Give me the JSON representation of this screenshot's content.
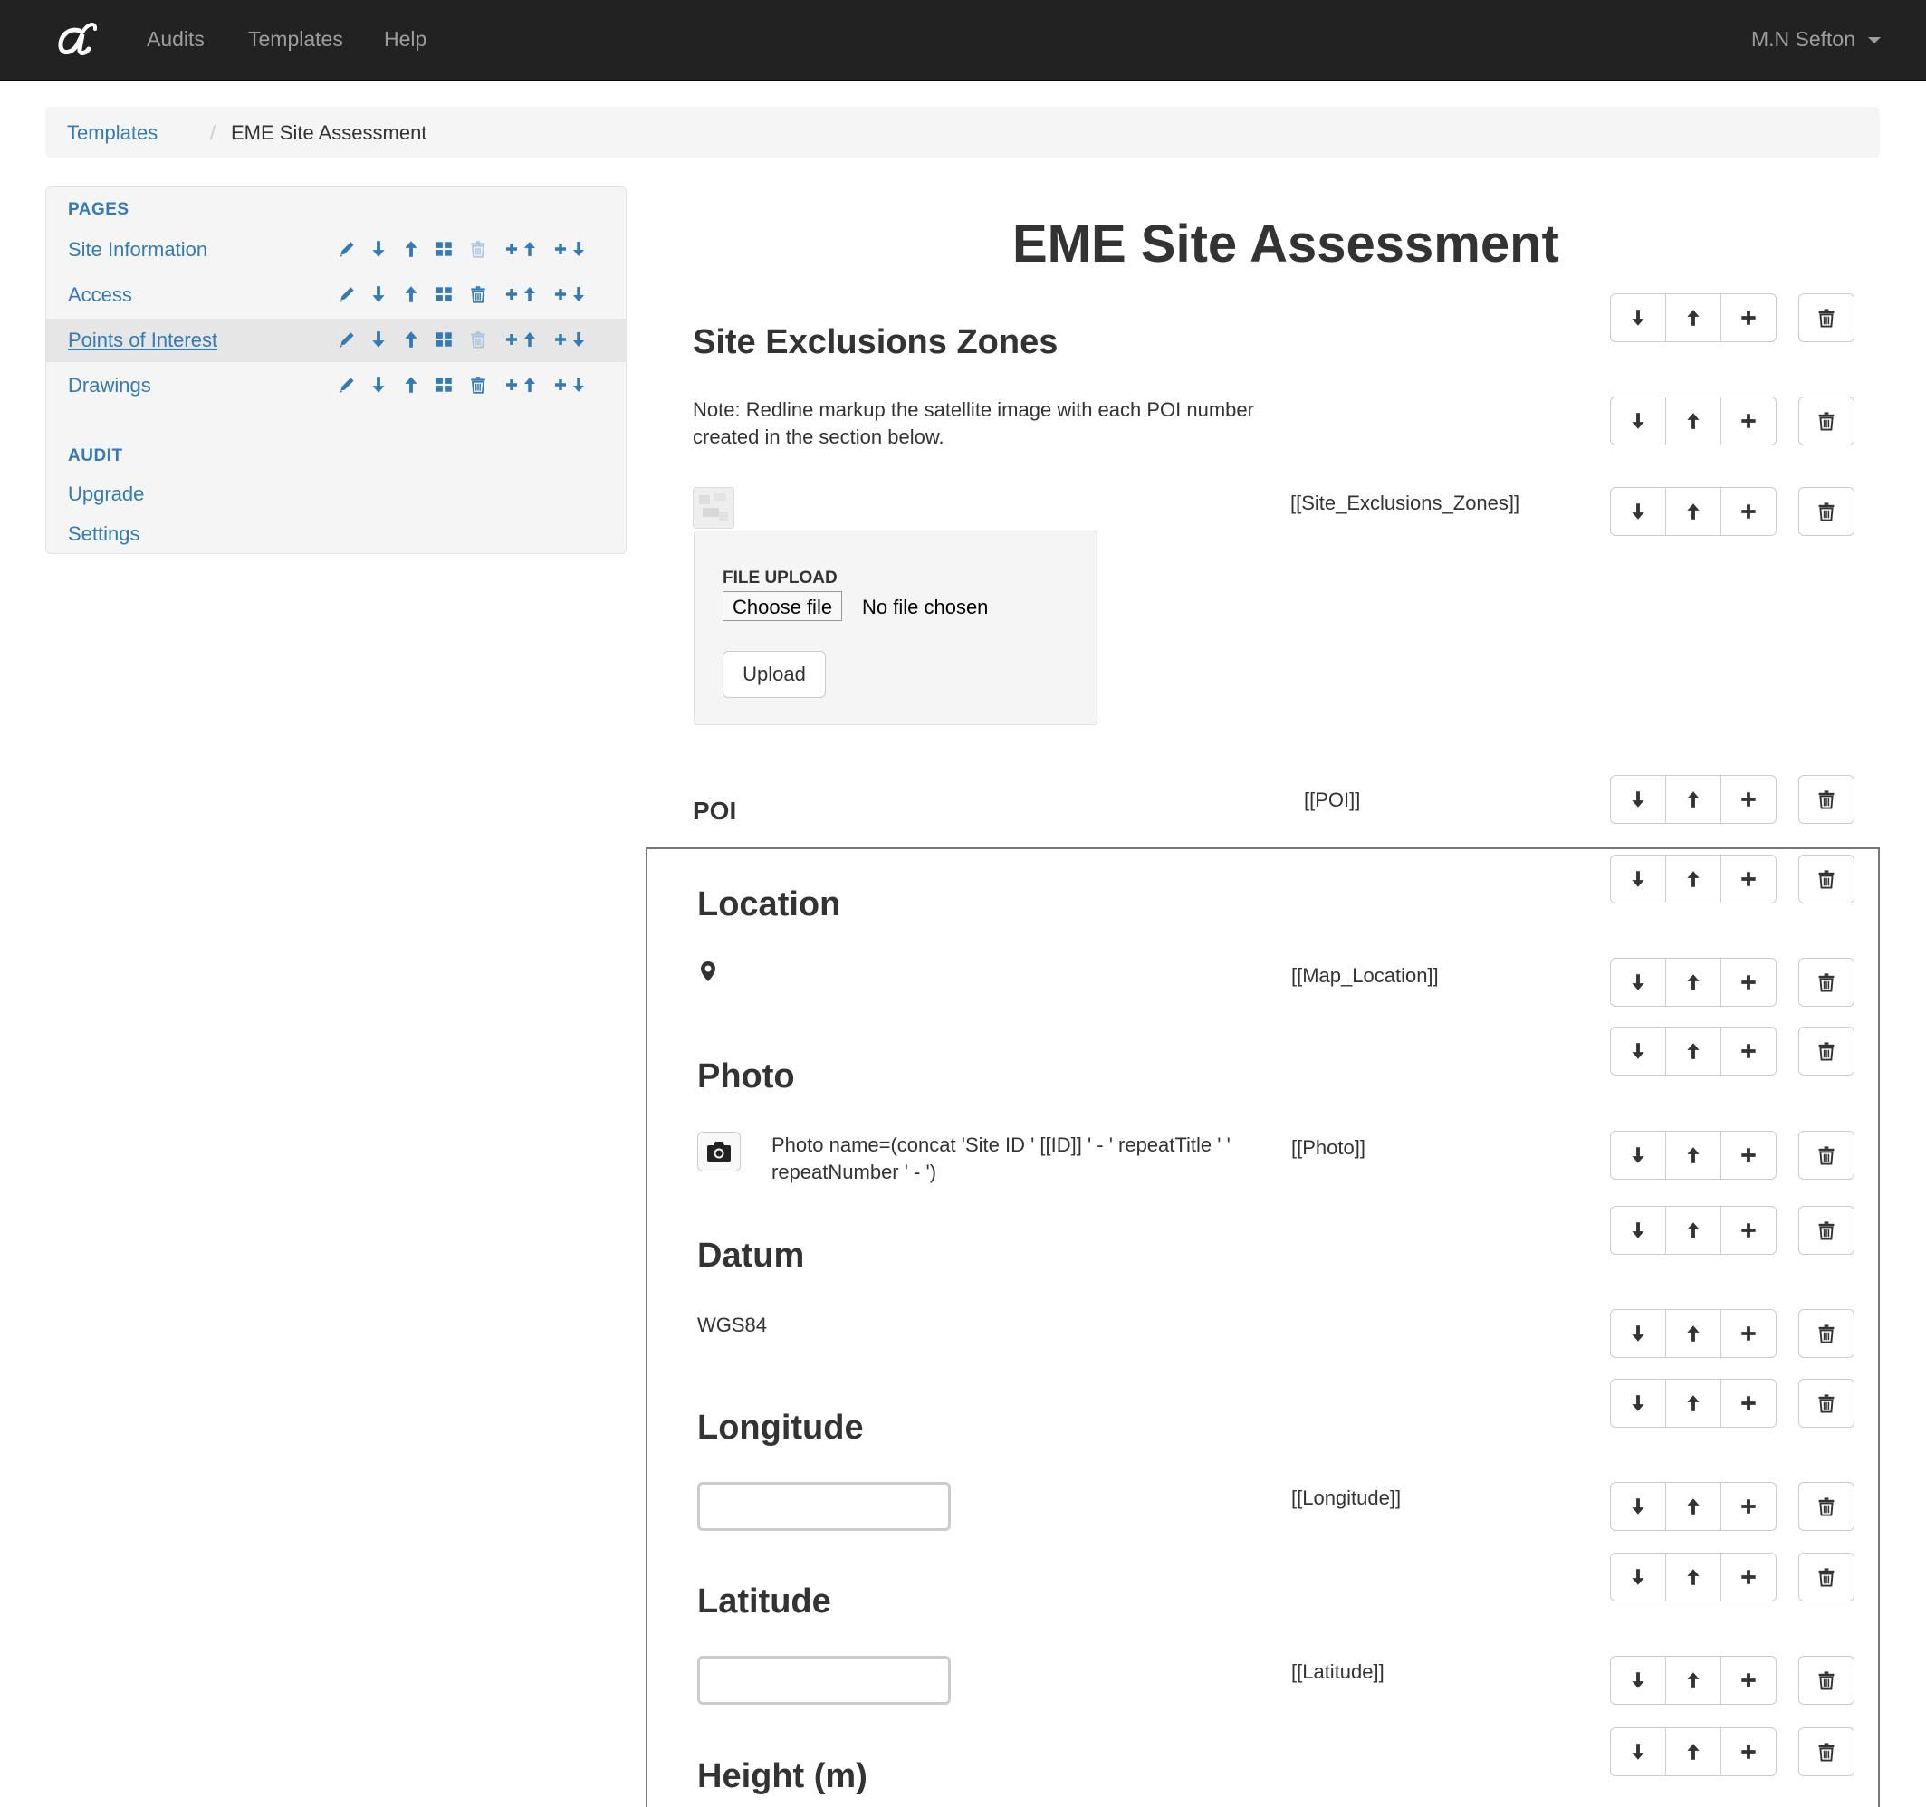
{
  "navbar": {
    "logo_alt": "a",
    "links": [
      "Audits",
      "Templates",
      "Help"
    ],
    "user": "M.N Sefton"
  },
  "breadcrumb": {
    "parent": "Templates",
    "separator": "/",
    "current": "EME Site Assessment"
  },
  "sidebar": {
    "pages_heading": "PAGES",
    "pages": [
      {
        "label": "Site Information",
        "active": false
      },
      {
        "label": "Access",
        "active": false
      },
      {
        "label": "Points of Interest",
        "active": true
      },
      {
        "label": "Drawings",
        "active": false
      }
    ],
    "row_icon_names": [
      "pencil-icon",
      "arrow-down-icon",
      "arrow-up-icon",
      "grid-icon",
      "trash-icon",
      "insert-above-icon",
      "insert-below-icon"
    ],
    "audit_heading": "AUDIT",
    "audit_links": [
      "Upgrade",
      "Settings"
    ]
  },
  "main": {
    "title": "EME Site Assessment",
    "site_exclusions": {
      "title": "Site Exclusions Zones",
      "note": "Note: Redline markup the satellite image with each POI number created in the section below.",
      "token": "[[Site_Exclusions_Zones]]",
      "upload": {
        "label": "FILE UPLOAD",
        "choose_button": "Choose file",
        "status": "No file chosen",
        "upload_button": "Upload"
      }
    },
    "poi": {
      "label": "POI",
      "token": "[[POI]]"
    },
    "location": {
      "title": "Location",
      "token": "[[Map_Location]]"
    },
    "photo": {
      "title": "Photo",
      "note": "Photo name=(concat 'Site ID ' [[ID]] ' - ' repeatTitle ' ' repeatNumber ' - ')",
      "token": "[[Photo]]"
    },
    "datum": {
      "title": "Datum",
      "value": "WGS84"
    },
    "longitude": {
      "title": "Longitude",
      "value": "",
      "token": "[[Longitude]]"
    },
    "latitude": {
      "title": "Latitude",
      "value": "",
      "token": "[[Latitude]]"
    },
    "height": {
      "title": "Height (m)"
    }
  },
  "colors": {
    "navbar_bg": "#222222",
    "link": "#337ab7",
    "text": "#333333",
    "sidebar_bg": "#f5f5f5",
    "active_row": "#e6e6e6"
  }
}
